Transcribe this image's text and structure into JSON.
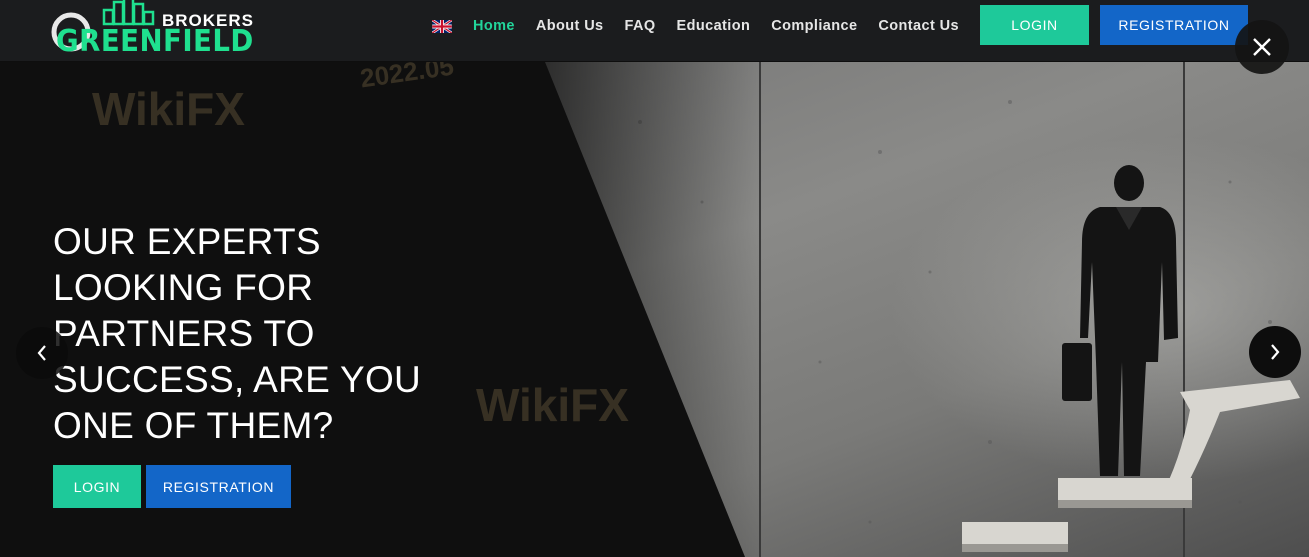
{
  "header": {
    "logo_top": "BROKERS",
    "logo_main": "GREENFIELD",
    "nav": [
      {
        "label": "Home",
        "active": true
      },
      {
        "label": "About Us"
      },
      {
        "label": "FAQ"
      },
      {
        "label": "Education"
      },
      {
        "label": "Compliance"
      },
      {
        "label": "Contact Us"
      }
    ],
    "login_label": "LOGIN",
    "registration_label": "REGISTRATION",
    "language_icon": "uk-flag-icon"
  },
  "hero": {
    "headline_lines": [
      "OUR EXPERTS",
      "LOOKING FOR",
      "PARTNERS TO",
      "SUCCESS, ARE YOU",
      "ONE OF THEM?"
    ],
    "login_label": "LOGIN",
    "registration_label": "REGISTRATION"
  },
  "watermark": {
    "text": "WikiFX",
    "date": "2022.05"
  },
  "colors": {
    "accent_green": "#1ec99a",
    "accent_blue": "#1366c8",
    "active_nav": "#22d49a",
    "header_bg": "#1b1c1e"
  },
  "icons": {
    "close": "close-icon",
    "prev": "chevron-left-icon",
    "next": "chevron-right-icon"
  }
}
